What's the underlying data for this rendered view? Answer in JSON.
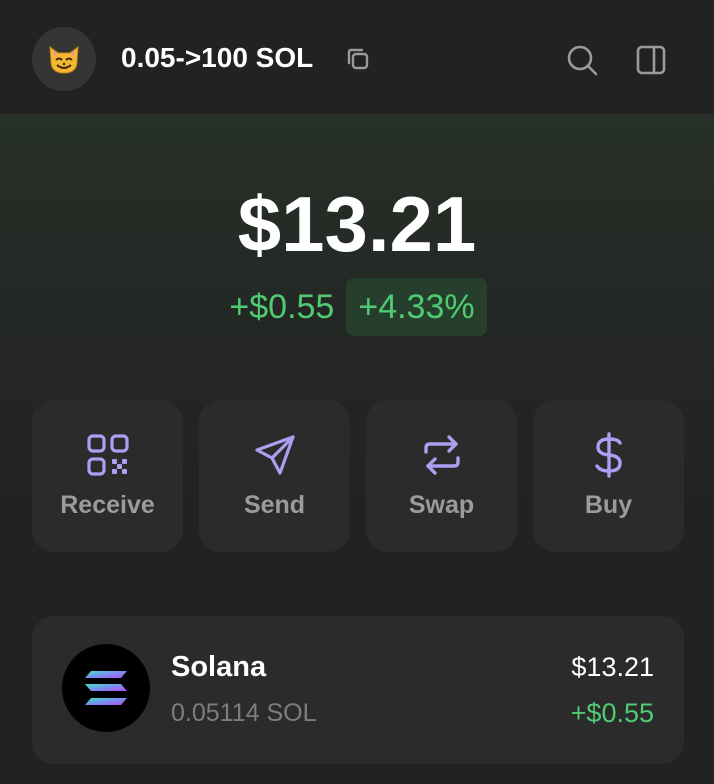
{
  "header": {
    "avatar_emoji": "😼",
    "account_name": "0.05->100 SOL",
    "copy_icon": "copy-icon",
    "search_icon": "search-icon",
    "sidebar_icon": "sidebar-panel-icon"
  },
  "balance": {
    "total": "$13.21",
    "change_amount": "+$0.55",
    "change_percent": "+4.33%"
  },
  "actions": [
    {
      "label": "Receive",
      "icon": "qr-code-icon"
    },
    {
      "label": "Send",
      "icon": "send-arrow-icon"
    },
    {
      "label": "Swap",
      "icon": "swap-arrows-icon"
    },
    {
      "label": "Buy",
      "icon": "dollar-icon"
    }
  ],
  "tokens": [
    {
      "name": "Solana",
      "amount": "0.05114 SOL",
      "value": "$13.21",
      "change": "+$0.55",
      "icon": "solana-logo-icon"
    }
  ],
  "colors": {
    "background": "#222222",
    "accent": "#ab9ff2",
    "positive": "#4fcb72",
    "card": "#2b2b2b"
  }
}
